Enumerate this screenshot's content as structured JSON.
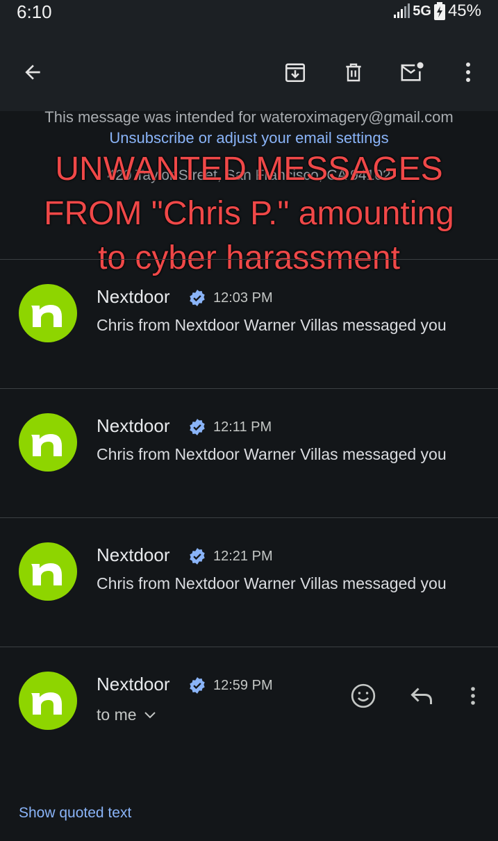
{
  "status": {
    "time": "6:10",
    "network": "5G",
    "battery": "45%"
  },
  "toolbar": {
    "icons": [
      "back-arrow-icon",
      "archive-icon",
      "delete-icon",
      "mark-unread-icon",
      "more-vert-icon"
    ]
  },
  "email_footer": {
    "intended": "This message was intended for wateroximagery@gmail.com",
    "unsubscribe": "Unsubscribe or adjust your email settings",
    "address": "420 Taylor Street, San Francisco, CA 94102"
  },
  "overlay": {
    "line1": "UNWANTED MESSAGES",
    "line2": "FROM \"Chris P.\" amounting",
    "line3": "to cyber harassment",
    "color": "#ef4848"
  },
  "messages": [
    {
      "sender": "Nextdoor",
      "time": "12:03 PM",
      "snippet": "Chris from Nextdoor Warner Villas messaged you"
    },
    {
      "sender": "Nextdoor",
      "time": "12:11 PM",
      "snippet": "Chris from Nextdoor Warner Villas messaged you"
    },
    {
      "sender": "Nextdoor",
      "time": "12:21 PM",
      "snippet": "Chris from Nextdoor Warner Villas messaged you"
    }
  ],
  "open_message": {
    "sender": "Nextdoor",
    "time": "12:59 PM",
    "recipient": "to me"
  },
  "show_quoted": "Show quoted text",
  "colors": {
    "avatar": "#8ed500",
    "link": "#8ab4f8",
    "verified": "#8ab4f8",
    "background": "#131619"
  }
}
